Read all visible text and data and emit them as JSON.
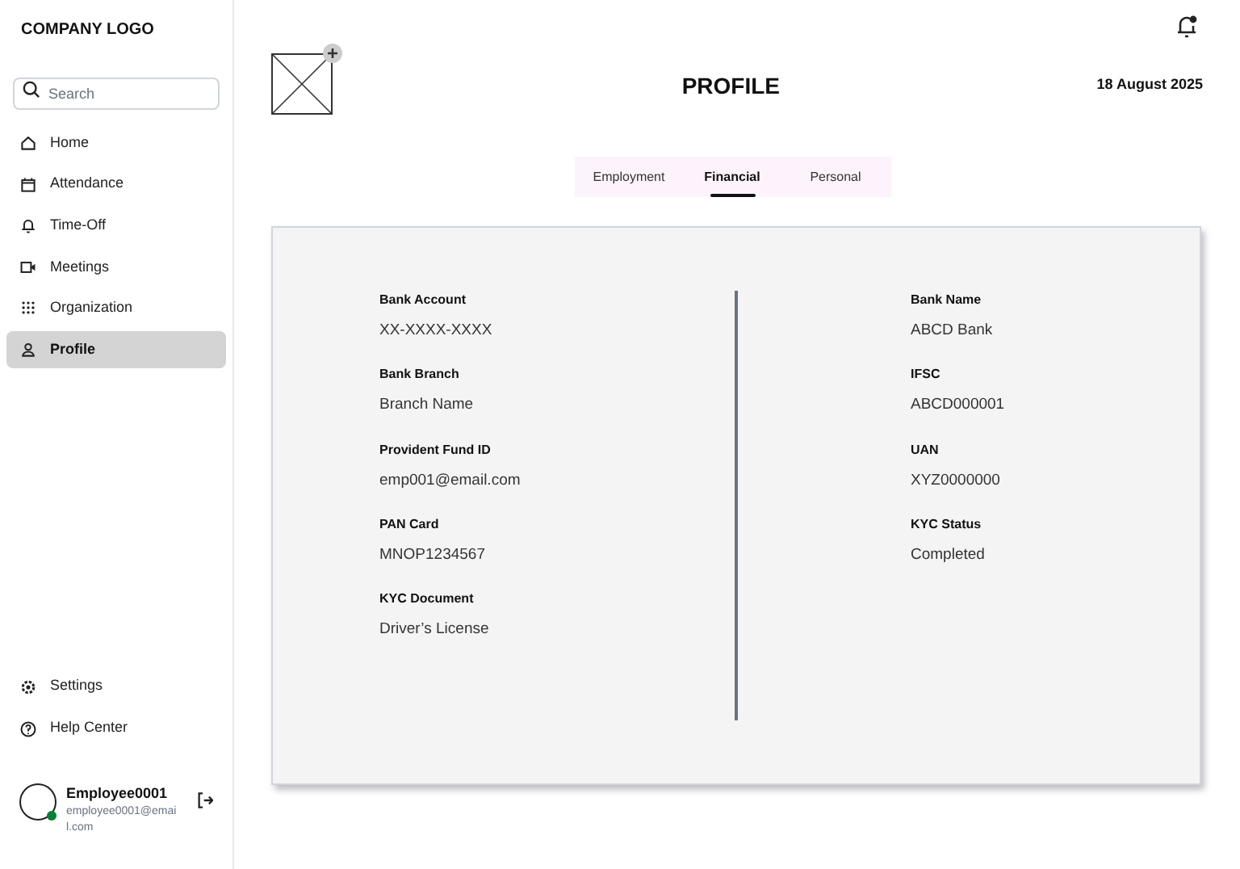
{
  "sidebar": {
    "logo": "COMPANY LOGO",
    "search": {
      "placeholder": "Search"
    },
    "items": [
      {
        "label": "Home",
        "selected": false
      },
      {
        "label": "Attendance",
        "selected": false
      },
      {
        "label": "Time-Off",
        "selected": false
      },
      {
        "label": "Meetings",
        "selected": false
      },
      {
        "label": "Organization",
        "selected": false
      },
      {
        "label": "Profile",
        "selected": true
      }
    ],
    "bottom_items": [
      {
        "label": "Settings"
      },
      {
        "label": "Help Center"
      }
    ],
    "user": {
      "name": "Employee0001",
      "email": "employee0001@email.com",
      "online": true
    }
  },
  "header": {
    "title": "PROFILE",
    "date": "18 August 2025"
  },
  "tabs": [
    {
      "label": "Employment",
      "selected": false
    },
    {
      "label": "Financial",
      "selected": true
    },
    {
      "label": "Personal",
      "selected": false
    }
  ],
  "details": {
    "left": [
      {
        "label": "Bank Account",
        "value": "XX-XXXX-XXXX"
      },
      {
        "label": "Bank Branch",
        "value": "Branch Name"
      },
      {
        "label": "Provident Fund ID",
        "value": "emp001@email.com"
      },
      {
        "label": "PAN Card",
        "value": "MNOP1234567"
      },
      {
        "label": "KYC Document",
        "value": "Driver’s License"
      }
    ],
    "right": [
      {
        "label": "Bank Name",
        "value": "ABCD Bank"
      },
      {
        "label": "IFSC",
        "value": "ABCD000001"
      },
      {
        "label": "UAN",
        "value": "XYZ0000000"
      },
      {
        "label": "KYC Status",
        "value": "Completed"
      }
    ]
  }
}
